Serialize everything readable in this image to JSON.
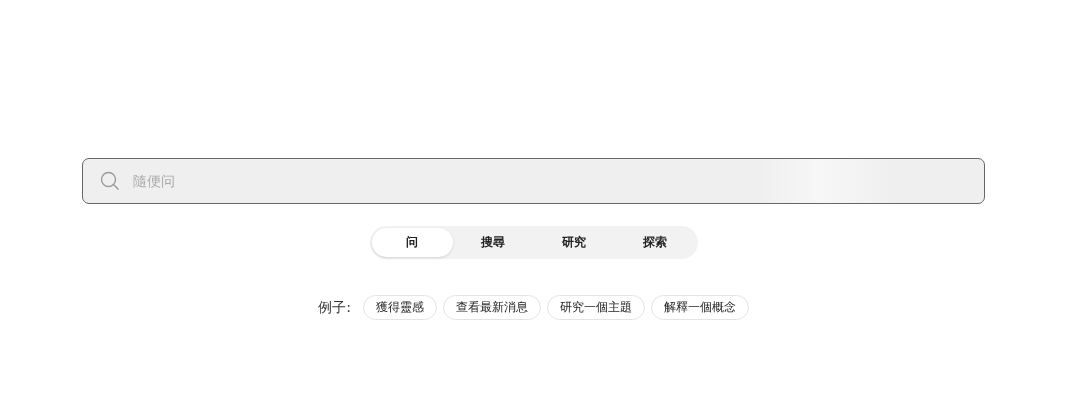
{
  "search": {
    "placeholder": "隨便问"
  },
  "modes": [
    {
      "label": "问",
      "selected": true
    },
    {
      "label": "搜尋",
      "selected": false
    },
    {
      "label": "研究",
      "selected": false
    },
    {
      "label": "探索",
      "selected": false
    }
  ],
  "examples": {
    "label": "例子:",
    "items": [
      "獲得靈感",
      "查看最新消息",
      "研究一個主題",
      "解釋一個概念"
    ]
  }
}
